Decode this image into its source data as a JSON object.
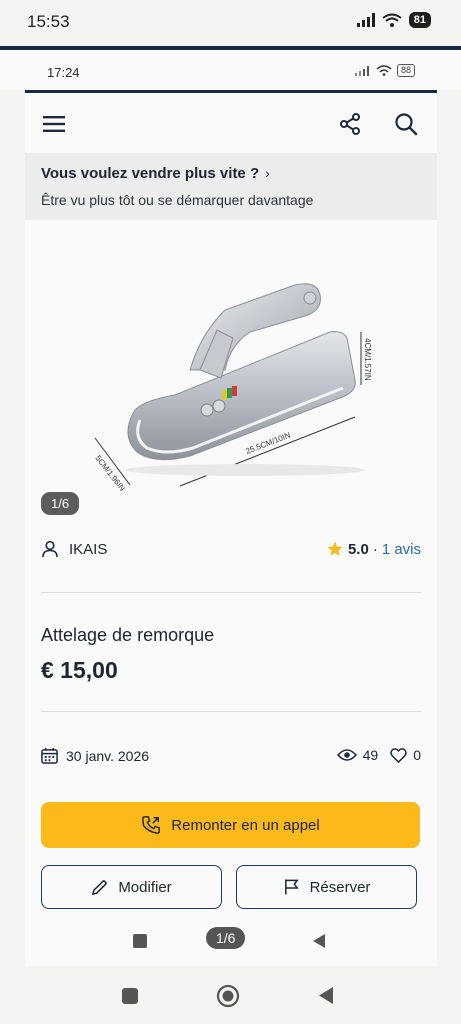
{
  "outer_status": {
    "time": "15:53",
    "battery": "81"
  },
  "inner_status": {
    "time": "17:24",
    "battery": "88"
  },
  "promo": {
    "title": "Vous voulez vendre plus vite ?",
    "chevron": "›",
    "subtitle": "Être vu plus tôt ou se démarquer davantage"
  },
  "photo": {
    "counter": "1/6",
    "dimension_height": "4CM/1.57IN",
    "dimension_length": "25.5CM/10IN",
    "dimension_width": "5CM/1.96IN"
  },
  "seller": {
    "name": "IKAIS"
  },
  "rating": {
    "value": "5.0",
    "separator": "·",
    "reviews": "1 avis"
  },
  "listing": {
    "title": "Attelage de remorque",
    "price": "€ 15,00"
  },
  "meta": {
    "date": "30 janv. 2026",
    "views": "49",
    "likes": "0"
  },
  "actions": {
    "call_label": "Remonter en un appel",
    "edit_label": "Modifier",
    "reserve_label": "Réserver"
  },
  "inner_nav": {
    "page_indicator": "1/6"
  },
  "colors": {
    "accent": "#fbb91a",
    "navy": "#152b49",
    "link": "#2a6ab3",
    "star": "#f5b921"
  },
  "icons": [
    "menu-icon",
    "share-icon",
    "search-icon",
    "user-icon",
    "star-icon",
    "calendar-icon",
    "eye-icon",
    "heart-icon",
    "phone-icon",
    "pencil-icon",
    "flag-icon"
  ]
}
